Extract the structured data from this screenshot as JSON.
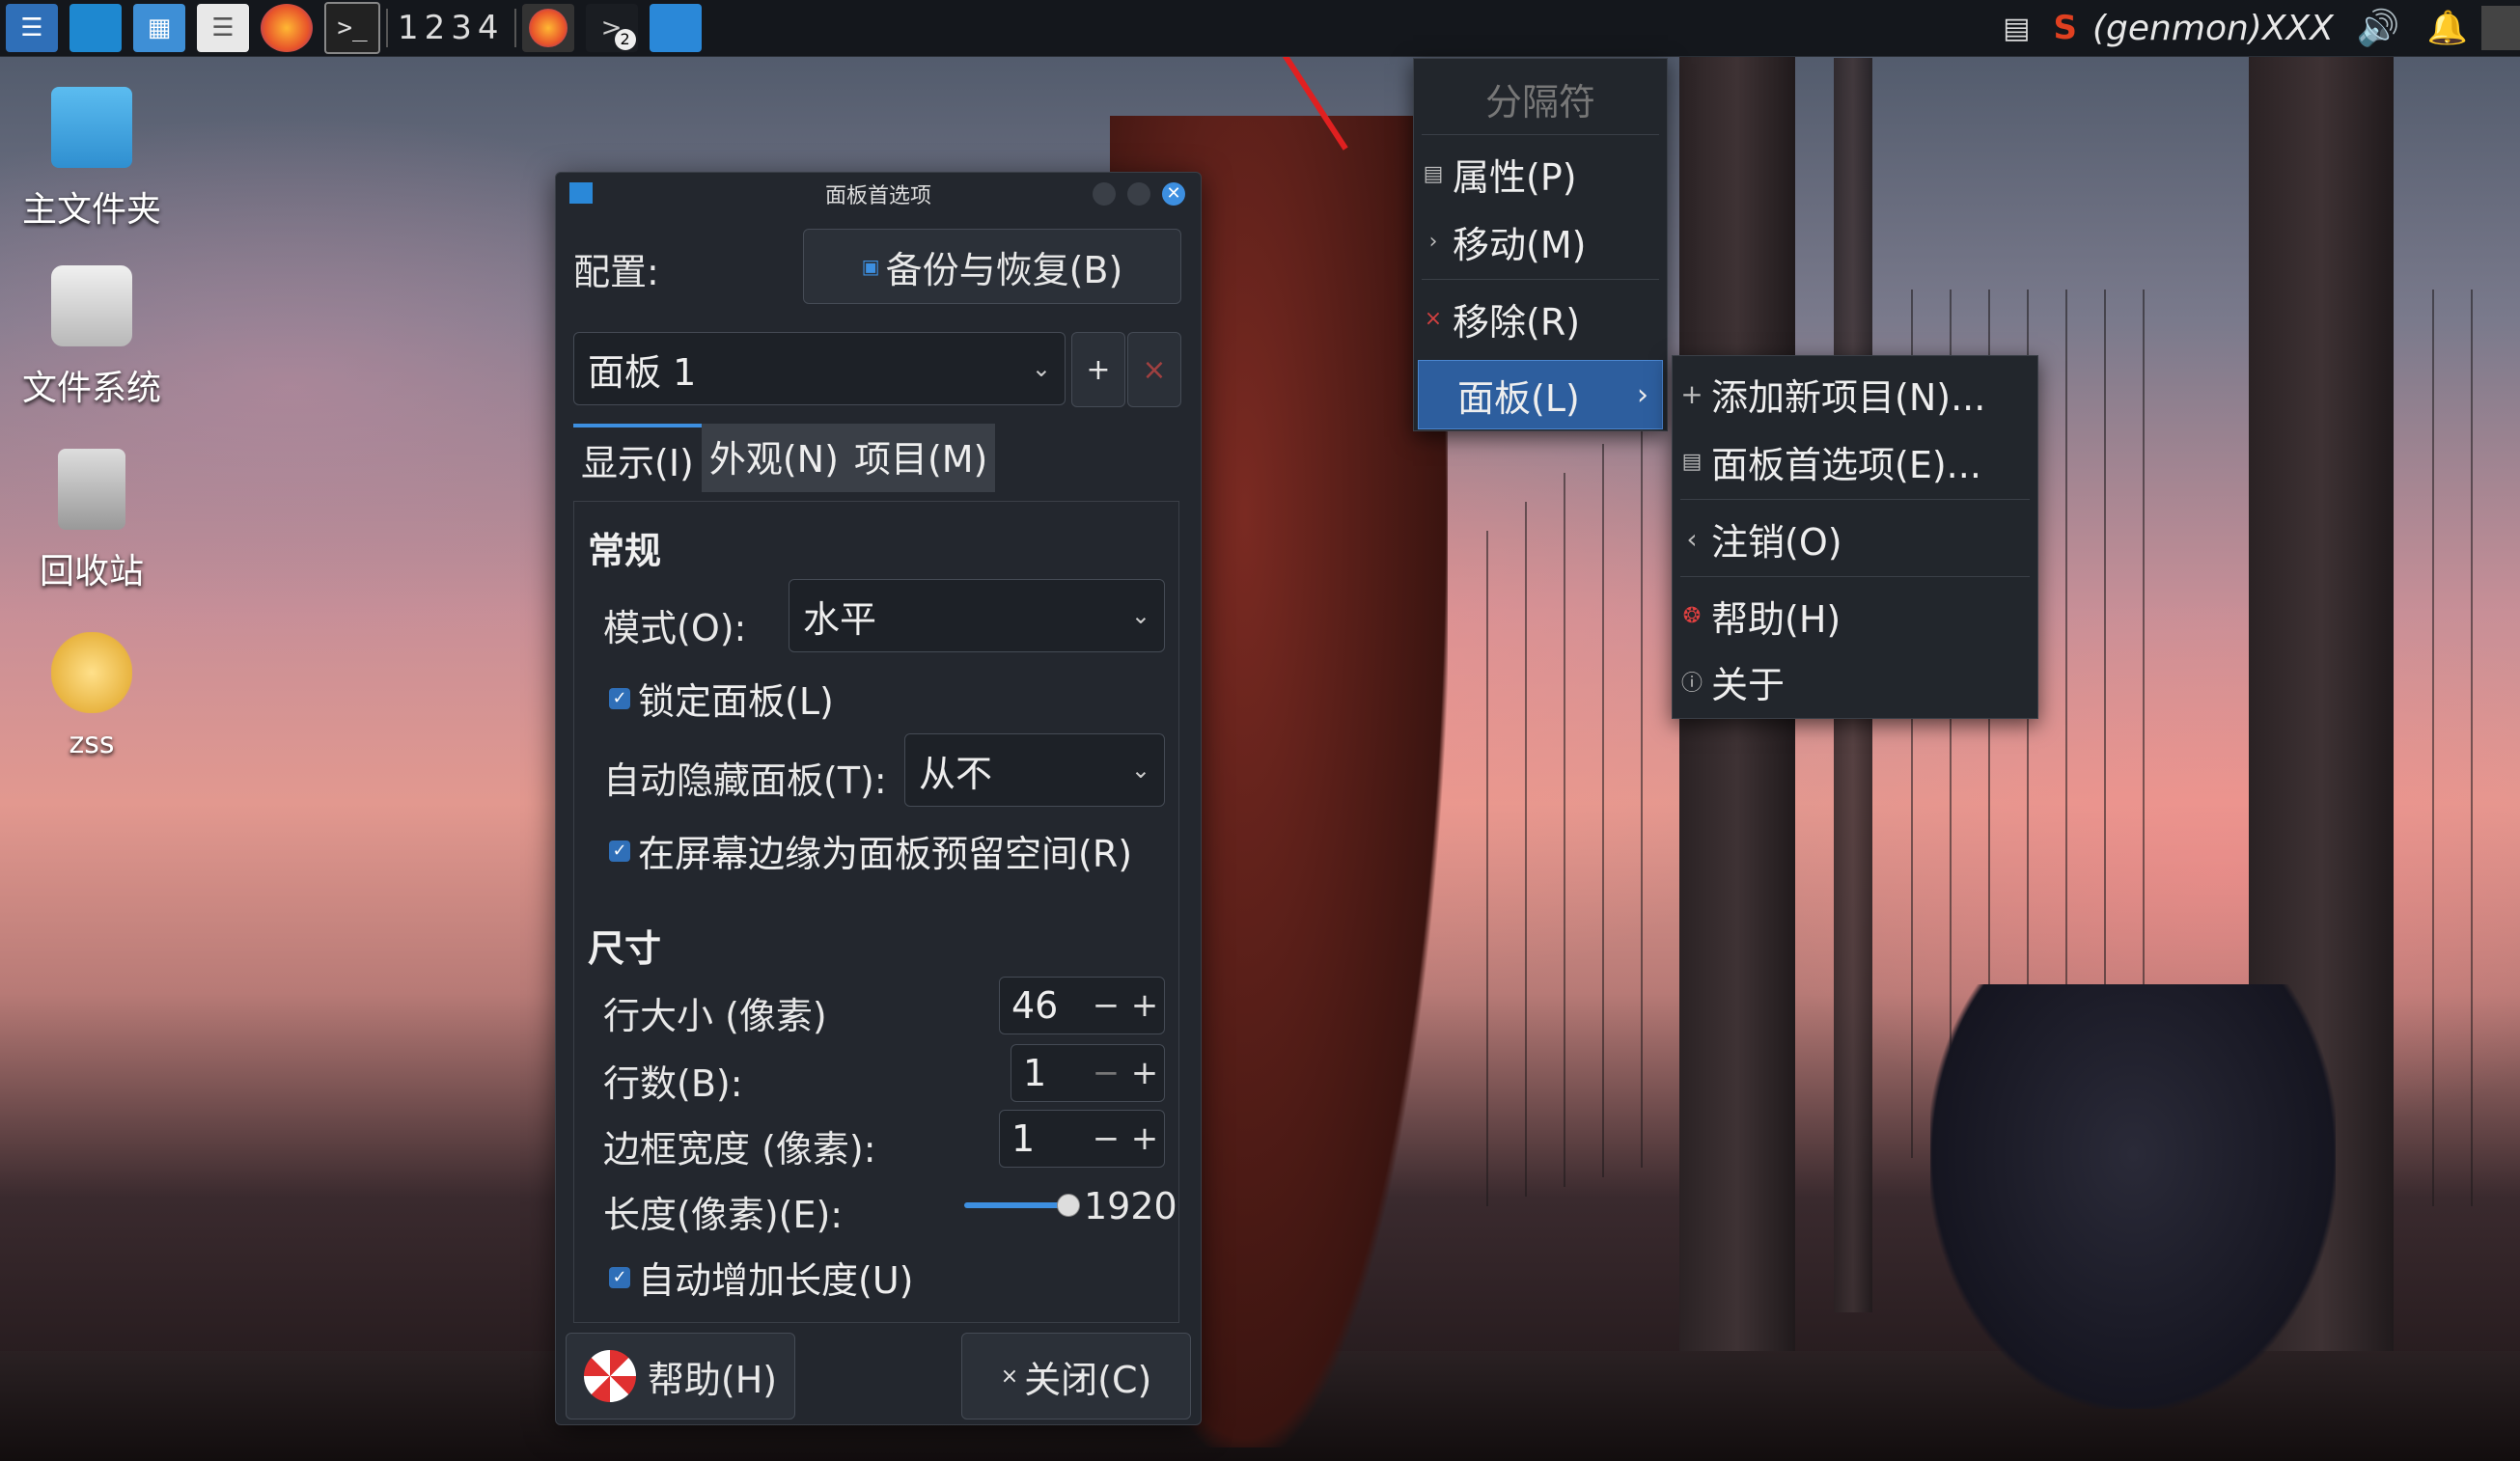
{
  "taskbar": {
    "workspaces": "1234",
    "tray_text": "(genmon)XXX",
    "badge_count": "2"
  },
  "desktop": {
    "icons": [
      {
        "label": "主文件夹"
      },
      {
        "label": "文件系统"
      },
      {
        "label": "回收站"
      },
      {
        "label": "zss"
      }
    ]
  },
  "dialog": {
    "title": "面板首选项",
    "config_label": "配置:",
    "backup_button": "备份与恢复(B)",
    "panel_select": "面板 1",
    "add_btn": "+",
    "remove_btn": "×",
    "tabs": [
      "显示(I)",
      "外观(N)",
      "项目(M)"
    ],
    "section_general": "常规",
    "mode_label": "模式(O):",
    "mode_value": "水平",
    "lock_panel": "锁定面板(L)",
    "autohide_label": "自动隐藏面板(T):",
    "autohide_value": "从不",
    "reserve_space": "在屏幕边缘为面板预留空间(R)",
    "section_size": "尺寸",
    "row_size_label": "行大小 (像素)",
    "row_size_value": "46",
    "rows_label": "行数(B):",
    "rows_value": "1",
    "border_label": "边框宽度 (像素):",
    "border_value": "1",
    "length_label": "长度(像素)(E):",
    "length_value": "1920",
    "auto_length": "自动增加长度(U)",
    "help_button": "帮助(H)",
    "close_button": "关闭(C)",
    "minus": "−",
    "plus": "+"
  },
  "context_menu": {
    "header": "分隔符",
    "items": [
      {
        "label": "属性(P)"
      },
      {
        "label": "移动(M)"
      },
      {
        "label": "移除(R)"
      },
      {
        "label": "面板(L)"
      }
    ]
  },
  "submenu": {
    "items": [
      {
        "label": "添加新项目(N)..."
      },
      {
        "label": "面板首选项(E)..."
      },
      {
        "label": "注销(O)"
      },
      {
        "label": "帮助(H)"
      },
      {
        "label": "关于"
      }
    ]
  },
  "colors": {
    "accent": "#3d8fe0",
    "menu_bg": "#22262c",
    "dialog_bg": "#23272e",
    "highlight": "#2d5e9e"
  }
}
